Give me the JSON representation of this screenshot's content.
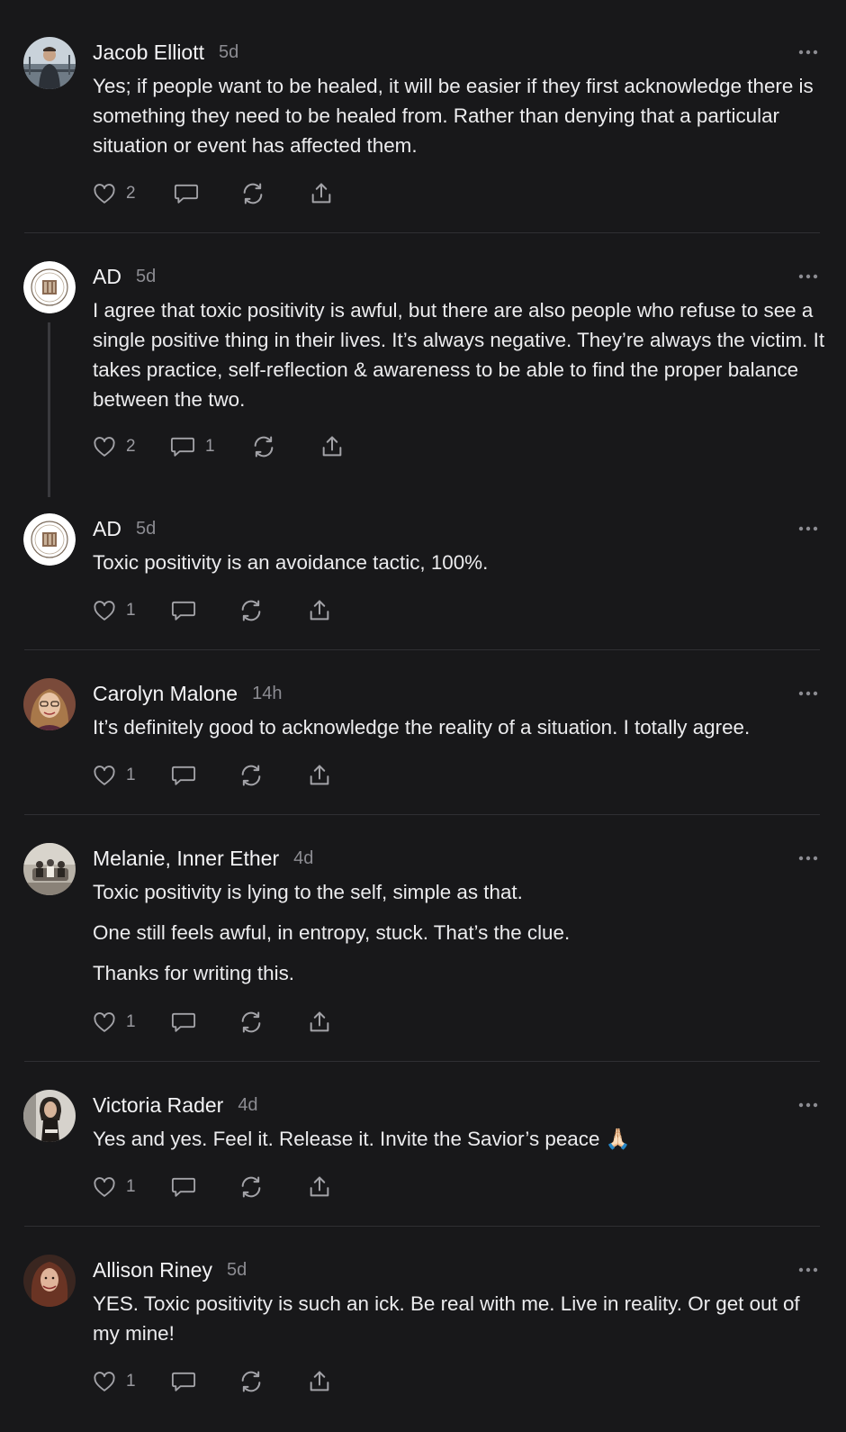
{
  "comments": [
    {
      "author": "Jacob Elliott",
      "time": "5d",
      "avatar": "person-photo-avatar",
      "paragraphs": [
        "Yes; if people want to be healed, it will be easier if they first acknowledge there is something they need to be healed from. Rather than denying that a particular situation or event has affected them."
      ],
      "likes": "2",
      "replies": ""
    },
    {
      "author": "AD",
      "time": "5d",
      "avatar": "logo-badge-avatar",
      "paragraphs": [
        "I agree that toxic positivity is awful, but there are also people who refuse to see a single positive thing in their lives. It’s always negative. They’re always the victim. It takes practice, self-reflection & awareness to be able to find the proper balance between the two."
      ],
      "likes": "2",
      "replies": "1"
    },
    {
      "author": "AD",
      "time": "5d",
      "avatar": "logo-badge-avatar",
      "paragraphs": [
        "Toxic positivity is an avoidance tactic, 100%."
      ],
      "likes": "1",
      "replies": ""
    },
    {
      "author": "Carolyn Malone",
      "time": "14h",
      "avatar": "person-photo-avatar",
      "paragraphs": [
        "It’s definitely good to acknowledge the reality of a situation. I totally agree."
      ],
      "likes": "1",
      "replies": ""
    },
    {
      "author": "Melanie, Inner Ether",
      "time": "4d",
      "avatar": "group-photo-avatar",
      "paragraphs": [
        "Toxic positivity is lying to the self, simple as that.",
        "One still feels awful, in entropy, stuck. That’s the clue.",
        "Thanks for writing this."
      ],
      "likes": "1",
      "replies": ""
    },
    {
      "author": "Victoria Rader",
      "time": "4d",
      "avatar": "person-photo-avatar",
      "paragraphs": [
        "Yes and yes. Feel it. Release it. Invite the Savior’s peace 🙏🏻"
      ],
      "likes": "1",
      "replies": ""
    },
    {
      "author": "Allison Riney",
      "time": "5d",
      "avatar": "person-photo-avatar",
      "paragraphs": [
        "YES. Toxic positivity is such an ick. Be real with me. Live in reality. Or get out of my mine!"
      ],
      "likes": "1",
      "replies": ""
    }
  ],
  "colors": {
    "background": "#18181a",
    "text": "#efeff1",
    "muted": "#8c8c92",
    "divider": "#2f2f33",
    "icon": "#a3a3a8"
  },
  "icons": {
    "like": "heart-icon",
    "reply": "speech-bubble-icon",
    "restack": "restack-arrows-icon",
    "share": "share-upload-icon",
    "more": "more-ellipsis-icon"
  }
}
